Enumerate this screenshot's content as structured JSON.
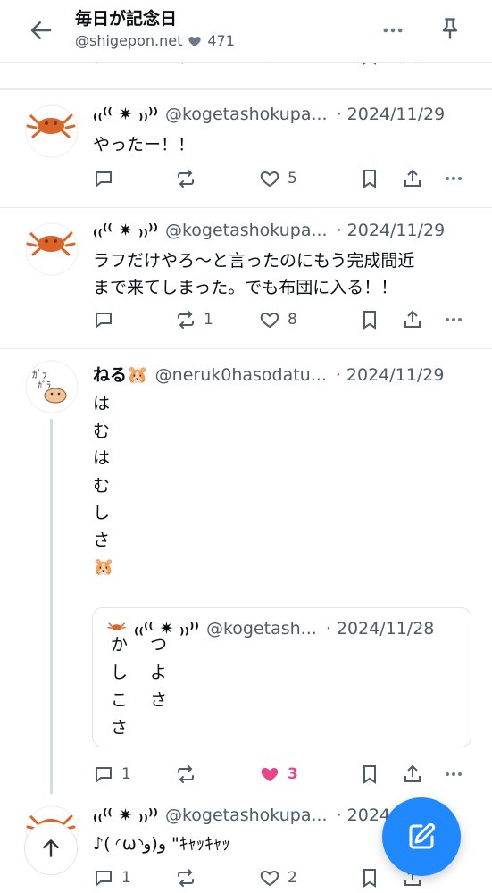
{
  "header": {
    "title": "毎日が記念日",
    "handle": "@shigepon.net",
    "likes": "471"
  },
  "posts": [
    {
      "display_name": "₍₍⁽⁽ ✷ ₎₎⁾⁾",
      "handle": "@kogetashokupa...",
      "date": "2024/11/29",
      "text": "やったー！！",
      "replies": "",
      "reposts": "",
      "likes": "5"
    },
    {
      "display_name": "₍₍⁽⁽ ✷ ₎₎⁾⁾",
      "handle": "@kogetashokupa...",
      "date": "2024/11/29",
      "text_lines": [
        "ラフだけやろ〜と言ったのにもう完成間近",
        "まで来てしまった。でも布団に入る！！"
      ],
      "replies": "",
      "reposts": "1",
      "likes": "8"
    },
    {
      "display_name": "ねる🐹",
      "handle": "@neruk0hasodatu...",
      "date": "2024/11/29",
      "text_lines": [
        "は",
        "む",
        "は",
        "む",
        "し",
        "さ",
        "🐹"
      ],
      "quote": {
        "display_name": "₍₍⁽⁽ ✷ ₎₎⁾⁾",
        "handle": "@kogetash...",
        "date": "2024/11/28",
        "col1": [
          "か",
          "し",
          "こ",
          "さ"
        ],
        "col2": [
          "つ",
          "よ",
          "さ"
        ]
      },
      "replies": "1",
      "reposts": "",
      "likes": "3"
    },
    {
      "display_name": "₍₍⁽⁽ ✷ ₎₎⁾⁾",
      "handle": "@kogetashokupa...",
      "date": "2024/11/29",
      "text": "♪( ◜ω◝و)و \"ｷｬｯｷｬｯ",
      "replies": "1",
      "reposts": "",
      "likes": "2"
    }
  ],
  "colors": {
    "accent": "#2089ff",
    "liked": "#e8458b",
    "muted": "#4f5b66",
    "border": "#e8ecef"
  }
}
